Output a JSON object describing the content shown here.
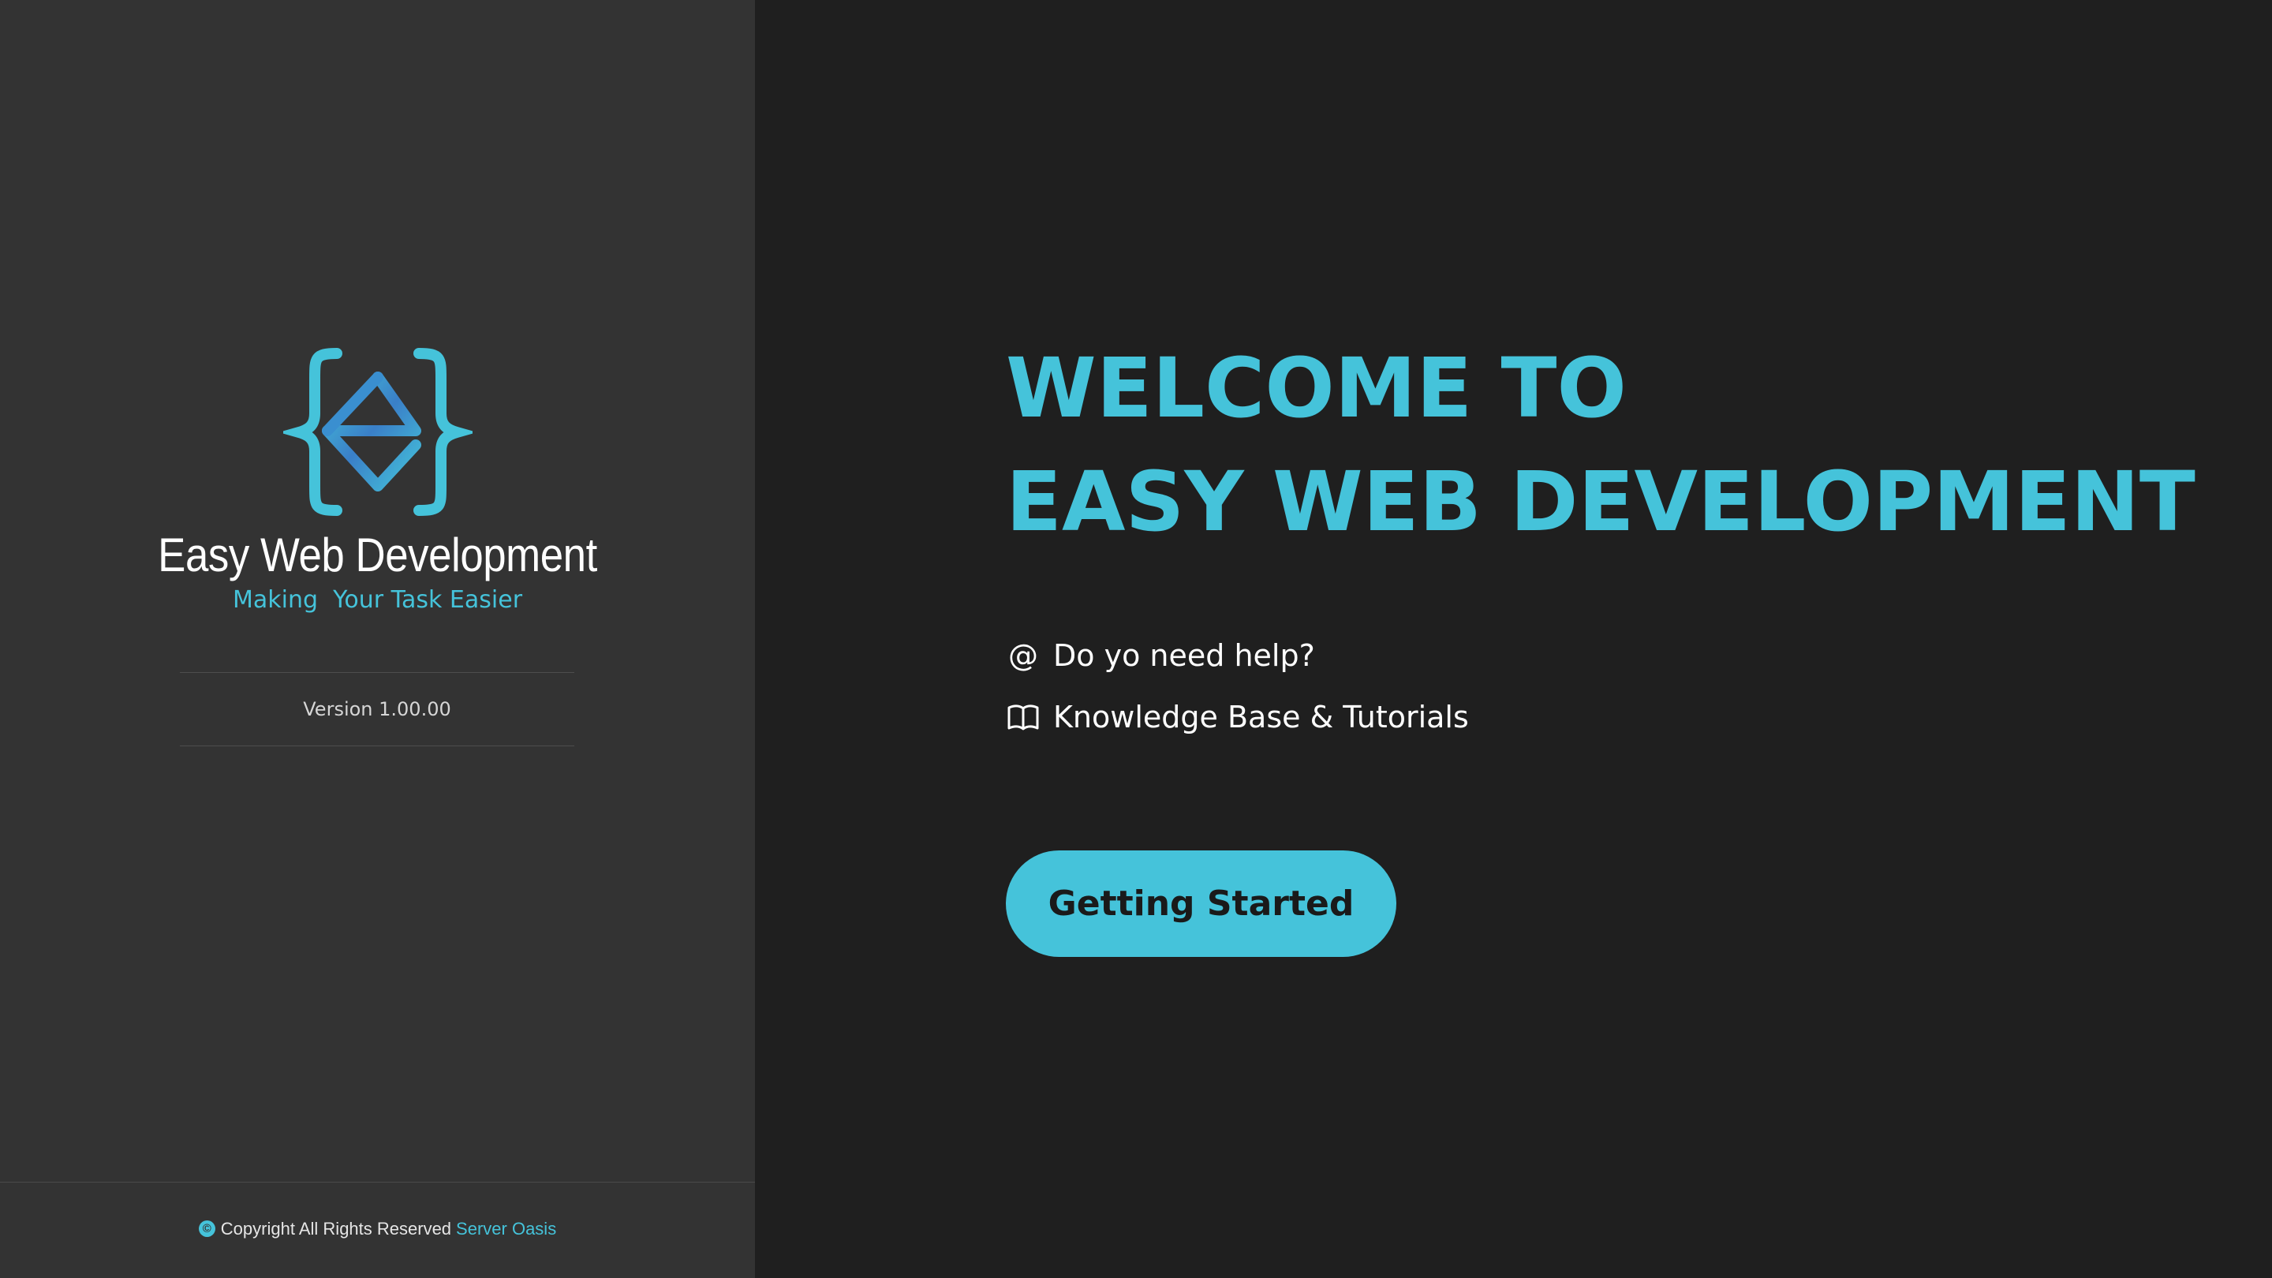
{
  "sidebar": {
    "brand_name": "Easy Web Development",
    "tagline": "Making  Your Task Easier",
    "version": "Version 1.00.00",
    "footer": {
      "copyright_text": "Copyright All Rights Reserved",
      "company_link": "Server Oasis"
    }
  },
  "main": {
    "title_line1": "WELCOME TO",
    "title_line2": "EASY WEB DEVELOPMENT",
    "links": [
      {
        "icon": "at-icon",
        "label": "Do yo need help?"
      },
      {
        "icon": "book-icon",
        "label": "Knowledge Base & Tutorials"
      }
    ],
    "cta_label": "Getting Started"
  },
  "colors": {
    "accent": "#45c3da",
    "sidebar_bg": "#333333",
    "main_bg": "#1f1f1f"
  }
}
